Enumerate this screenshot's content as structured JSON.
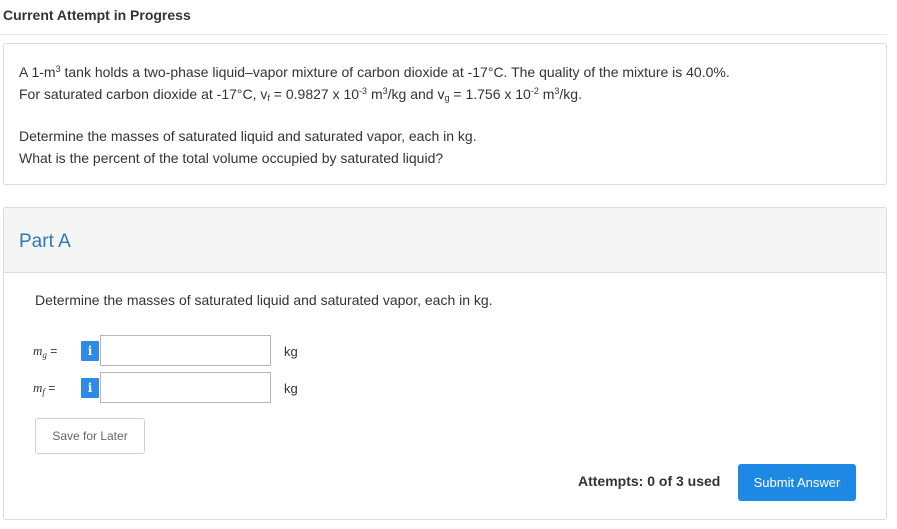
{
  "header": {
    "title": "Current Attempt in Progress"
  },
  "question": {
    "line1": {
      "a": "A 1-m",
      "sup": "3",
      "b": " tank holds a two-phase liquid–vapor mixture of carbon dioxide at -17°C. The quality of the mixture is 40.0%."
    },
    "line2": {
      "a": "For saturated carbon dioxide at -17°C, v",
      "sub1": "f",
      "b": " = 0.9827 x 10",
      "sup1": "-3",
      "c": " m",
      "sup2": "3",
      "d": "/kg and v",
      "sub2": "g",
      "e": " = 1.756 x 10",
      "sup3": "-2",
      "f": " m",
      "sup4": "3",
      "g": "/kg."
    },
    "line3": "Determine the masses of saturated liquid and saturated vapor, each in kg.",
    "line4": "What is the percent of the total volume occupied by saturated liquid?"
  },
  "part": {
    "title": "Part A",
    "prompt": "Determine the masses of saturated liquid and saturated vapor, each in kg.",
    "fields": [
      {
        "var": "m",
        "sub": "g",
        "eq": " =",
        "info": "i",
        "value": "",
        "unit": "kg"
      },
      {
        "var": "m",
        "sub": "f",
        "eq": " =",
        "info": "i",
        "value": "",
        "unit": "kg"
      }
    ],
    "save_label": "Save for Later",
    "attempts_label": "Attempts: 0 of 3 used",
    "submit_label": "Submit Answer"
  },
  "colors": {
    "accent": "#1e88e5",
    "info_button": "#2f89e6",
    "part_title": "#2a7ab8"
  }
}
